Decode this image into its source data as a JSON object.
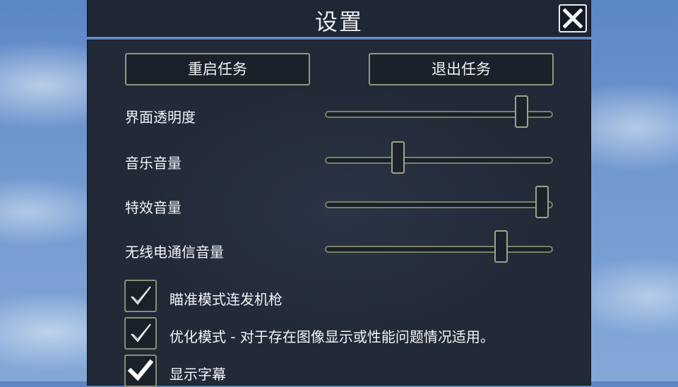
{
  "header": {
    "title": "设置"
  },
  "actions": {
    "restart_label": "重启任务",
    "exit_label": "退出任务"
  },
  "sliders": [
    {
      "label": "界面透明度",
      "value": 0.86
    },
    {
      "label": "音乐音量",
      "value": 0.32
    },
    {
      "label": "特效音量",
      "value": 0.95
    },
    {
      "label": "无线电通信音量",
      "value": 0.77
    }
  ],
  "checkboxes": [
    {
      "label": "瞄准模式连发机枪",
      "checked": true,
      "style": "thin"
    },
    {
      "label": "优化模式 - 对于存在图像显示或性能问题情况适用。",
      "checked": true,
      "style": "thin"
    },
    {
      "label": "显示字幕",
      "checked": true,
      "style": "bold"
    }
  ],
  "icons": {
    "close": "close-icon",
    "check": "checkmark-icon"
  },
  "colors": {
    "panel": "#222a38",
    "border_accent": "#8f9a7c",
    "text": "#f2f4f6"
  }
}
